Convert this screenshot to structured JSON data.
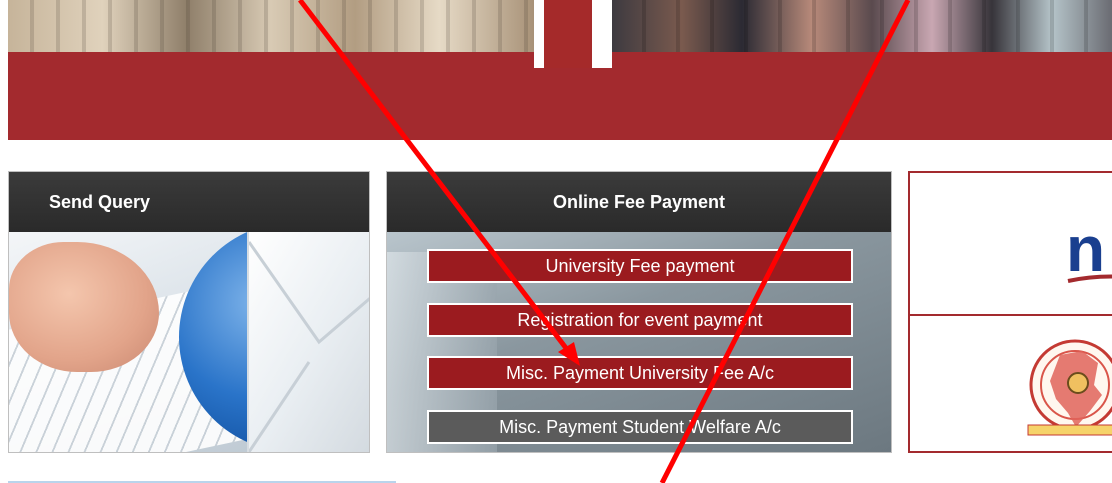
{
  "send_query": {
    "title": "Send Query"
  },
  "online_fee": {
    "title": "Online Fee Payment",
    "buttons": [
      "University Fee payment",
      "Registration for event payment",
      "Misc. Payment University Fee A/c",
      "Misc. Payment Student Welfare A/c"
    ]
  },
  "logos": {
    "top_logo_text": "n"
  },
  "colors": {
    "banner_red": "#a32a2e",
    "button_red": "#9b1b1f",
    "button_gray": "#5b5b5b",
    "annotation_red": "#ff0000"
  },
  "icons": [
    "envelope-icon",
    "keyboard-image",
    "nirf-logo",
    "naac-logo"
  ]
}
